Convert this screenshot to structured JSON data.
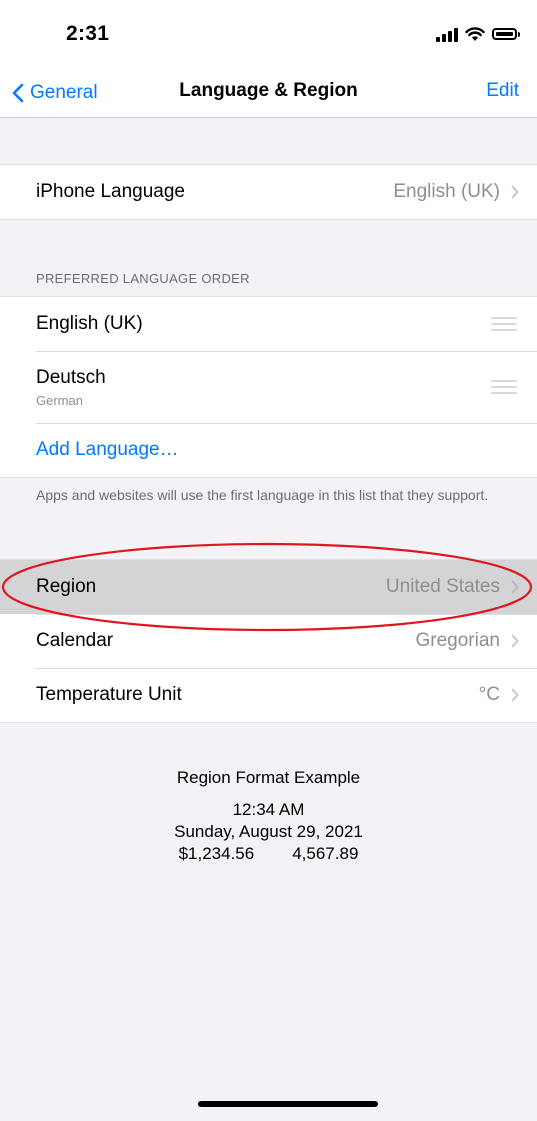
{
  "status": {
    "time": "2:31",
    "icons": [
      "signal-icon",
      "wifi-icon",
      "battery-icon"
    ]
  },
  "nav": {
    "back_label": "General",
    "title": "Language & Region",
    "edit_label": "Edit"
  },
  "language": {
    "label": "iPhone Language",
    "value": "English (UK)"
  },
  "preferred": {
    "header": "PREFERRED LANGUAGE ORDER",
    "items": [
      {
        "label": "English (UK)",
        "sub": ""
      },
      {
        "label": "Deutsch",
        "sub": "German"
      }
    ],
    "add_label": "Add Language…",
    "footer": "Apps and websites will use the first language in this list that they support."
  },
  "region": {
    "rows": [
      {
        "label": "Region",
        "value": "United States",
        "highlighted": true
      },
      {
        "label": "Calendar",
        "value": "Gregorian"
      },
      {
        "label": "Temperature Unit",
        "value": "°C"
      }
    ]
  },
  "format_example": {
    "title": "Region Format Example",
    "time": "12:34 AM",
    "date": "Sunday, August 29, 2021",
    "currency": "$1,234.56",
    "number": "4,567.89"
  },
  "colors": {
    "accent": "#007aff",
    "annotation": "#e0161f",
    "highlight": "#d4d4d7"
  }
}
